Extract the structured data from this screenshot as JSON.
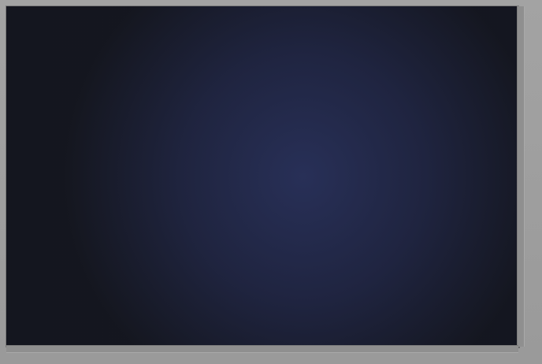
{
  "app": {
    "canvas": {
      "name": "digital-painting-canvas"
    }
  },
  "palette": {
    "swatches": [
      {
        "id": "cream-light",
        "color": "#fffbea"
      },
      {
        "id": "mint-light",
        "color": "#e4f5cf"
      },
      {
        "id": "peach-light",
        "color": "#ffe2be"
      },
      {
        "id": "skin-mid",
        "color": "#efb389"
      },
      {
        "id": "salmon",
        "color": "#f69072"
      },
      {
        "id": "red-orange",
        "color": "#cf4743"
      },
      {
        "id": "deep-red",
        "color": "#711c17"
      },
      {
        "id": "muted-purple",
        "color": "#5a4966"
      },
      {
        "id": "violet",
        "color": "#512d76"
      },
      {
        "id": "lavender-plum",
        "color": "#724d8a"
      }
    ]
  },
  "colors": {
    "background_dark": "#1d1d19",
    "background_blue": "#252b4a",
    "skin_light": "#f7b089",
    "skin_mid": "#eb9b77",
    "skin_dark": "#b75a4a",
    "shadow_red": "#8d3b34",
    "line_white": "#e8ddd3"
  }
}
